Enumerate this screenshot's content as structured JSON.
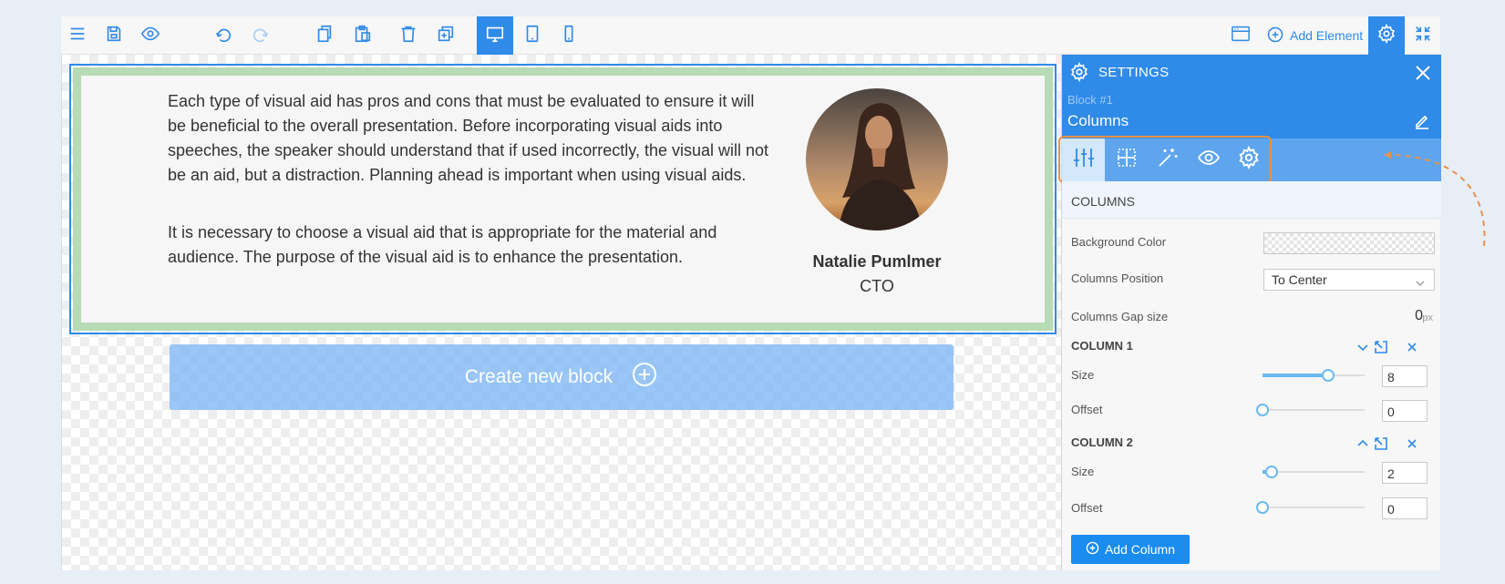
{
  "toolbar": {
    "icons": {
      "menu": "hamburger-icon",
      "save": "save-icon",
      "preview": "eye-icon",
      "undo": "undo-icon",
      "redo": "redo-icon",
      "copy": "copy-icon",
      "paste": "paste-icon",
      "delete": "trash-icon",
      "duplicate": "duplicate-icon",
      "desktop": "desktop-icon",
      "tablet": "tablet-icon",
      "mobile": "mobile-icon",
      "layout": "browser-window-icon",
      "settings": "gear-icon",
      "fullscreen": "collapse-icon"
    },
    "active_device": "desktop",
    "add_element_label": "Add Element"
  },
  "canvas": {
    "paragraphs": [
      "Each type of visual aid has pros and cons that must be evaluated to ensure it will be beneficial to the overall presentation. Before incorporating visual aids into speeches, the speaker should understand that if used incorrectly, the visual will not be an aid, but a distraction. Planning ahead is important when using visual aids.",
      "It is necessary to choose a visual aid that is appropriate for the material and audience. The purpose of the visual aid is to enhance the presentation."
    ],
    "person": {
      "name": "Natalie Pumlmer",
      "role": "CTO"
    },
    "create_block_label": "Create new block"
  },
  "settings": {
    "title": "SETTINGS",
    "block_id": "Block #1",
    "block_name": "Columns",
    "tabs": [
      "sliders-icon",
      "grid-icon",
      "magic-wand-icon",
      "eye-icon",
      "gear-icon"
    ],
    "active_tab": 0,
    "section_title": "COLUMNS",
    "background_color_label": "Background Color",
    "columns_position_label": "Columns Position",
    "columns_position_value": "To Center",
    "gap_label": "Columns Gap size",
    "gap_value": "0",
    "gap_unit": "px",
    "columns": [
      {
        "title": "COLUMN 1",
        "size_label": "Size",
        "size": "8",
        "offset_label": "Offset",
        "offset": "0",
        "size_fraction": 0.64,
        "offset_fraction": 0
      },
      {
        "title": "COLUMN 2",
        "size_label": "Size",
        "size": "2",
        "offset_label": "Offset",
        "offset": "0",
        "size_fraction": 0.09,
        "offset_fraction": 0
      }
    ],
    "add_column_label": "Add Column"
  },
  "colors": {
    "accent": "#2f8ae8",
    "tab_bar": "#5ea5ee",
    "highlight_frame": "#e8914a",
    "block_border": "#b7dbb4"
  }
}
